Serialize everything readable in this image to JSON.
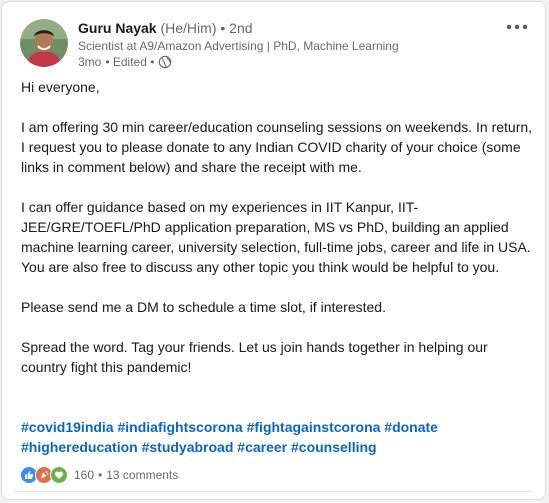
{
  "author": {
    "name": "Guru Nayak",
    "pronouns": "(He/Him)",
    "degree": "• 2nd",
    "headline": "Scientist at A9/Amazon Advertising | PhD, Machine Learning",
    "time": "3mo",
    "edited": "• Edited •",
    "visibility_icon": "globe-icon"
  },
  "more_icon": "ellipsis-icon",
  "post": {
    "paragraphs": [
      "Hi everyone,",
      "I am offering 30 min career/education counseling sessions on weekends. In return, I request you to please donate to any Indian COVID charity of your choice (some links in comment below) and share the receipt with me.",
      "I can offer guidance based on my experiences in IIT Kanpur, IIT-JEE/GRE/TOEFL/PhD application preparation, MS vs PhD, building an applied machine learning career, university selection, full-time jobs, career and life in USA. You are also free to discuss any other topic you think would be helpful to you.",
      "Please send me a DM to schedule a time slot, if interested.",
      "Spread the word. Tag your friends. Let us join hands together in helping our country fight this pandemic!"
    ],
    "hashtags": [
      "#covid19india",
      "#indiafightscorona",
      "#fightagainstcorona",
      "#donate",
      "#highereducation",
      "#studyabroad",
      "#career",
      "#counselling"
    ]
  },
  "social": {
    "reaction_icons": [
      "like-icon",
      "celebrate-icon",
      "support-icon"
    ],
    "reaction_count": "160",
    "separator": "•",
    "comments": "13 comments"
  },
  "colors": {
    "link": "#0a66c2",
    "like": "#378fe9",
    "celebrate": "#df704d",
    "support": "#6dae4f"
  }
}
